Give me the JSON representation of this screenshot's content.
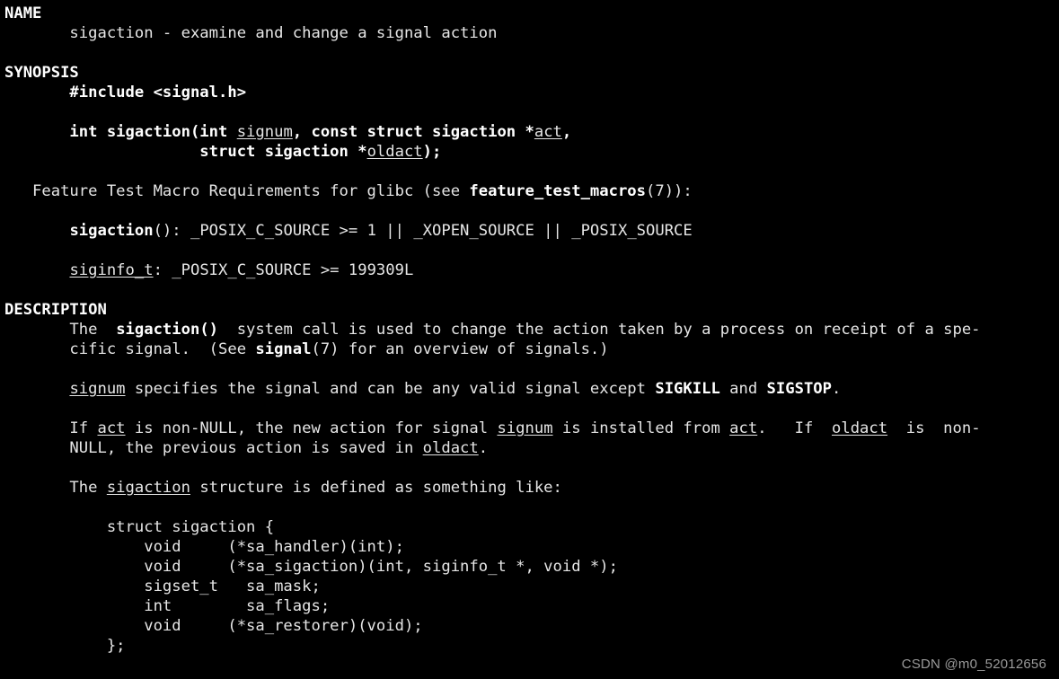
{
  "terminal": {
    "background_color": "#000000",
    "text_color": "#e6e6e6",
    "watermark": "CSDN @m0_52012656"
  },
  "manpage": {
    "sections": {
      "name_heading": "NAME",
      "synopsis_heading": "SYNOPSIS",
      "description_heading": "DESCRIPTION"
    },
    "lines": {
      "name_desc": "       sigaction - examine and change a signal action",
      "synopsis_include": "       #include <signal.h>",
      "proto_1_a": "       int sigaction(int ",
      "proto_1_signum": "signum",
      "proto_1_b": ", const struct sigaction *",
      "proto_1_act": "act",
      "proto_1_c": ",",
      "proto_2_a": "                     struct sigaction *",
      "proto_2_oldact": "oldact",
      "proto_2_b": ");",
      "ftm_a": "   Feature Test Macro Requirements for glibc (see ",
      "ftm_bold": "feature_test_macros",
      "ftm_b": "(7)):",
      "ftm_sigaction_bold": "sigaction",
      "ftm_sigaction_rest": "(): _POSIX_C_SOURCE >= 1 || _XOPEN_SOURCE || _POSIX_SOURCE",
      "ftm_indent": "       ",
      "ftm_siginfo_u": "siginfo_t",
      "ftm_siginfo_rest": ": _POSIX_C_SOURCE >= 199309L",
      "desc_1_a": "       The  ",
      "desc_1_bold": "sigaction()",
      "desc_1_b": "  system call is used to change the action taken by a process on receipt of a spe-",
      "desc_2_a": "       cific signal.  (See ",
      "desc_2_bold": "signal",
      "desc_2_b": "(7) for an overview of signals.)",
      "desc_3_u": "signum",
      "desc_3_a": " specifies the signal and can be any valid signal except ",
      "desc_3_b1": "SIGKILL",
      "desc_3_b": " and ",
      "desc_3_b2": "SIGSTOP",
      "desc_3_c": ".",
      "desc_4_pre": "       If ",
      "desc_4_act": "act",
      "desc_4_mid1": " is non-NULL, the new action for signal ",
      "desc_4_signum": "signum",
      "desc_4_mid2": " is installed from ",
      "desc_4_act2": "act",
      "desc_4_mid3": ".   If  ",
      "desc_4_oldact": "oldact",
      "desc_4_end": "  is  non-",
      "desc_5": "       NULL, the previous action is saved in ",
      "desc_5_oldact": "oldact",
      "desc_5_end": ".",
      "desc_6_pre": "       The ",
      "desc_6_u": "sigaction",
      "desc_6_end": " structure is defined as something like:",
      "struct_1": "           struct sigaction {",
      "struct_2": "               void     (*sa_handler)(int);",
      "struct_3": "               void     (*sa_sigaction)(int, siginfo_t *, void *);",
      "struct_4": "               sigset_t   sa_mask;",
      "struct_5": "               int        sa_flags;",
      "struct_6": "               void     (*sa_restorer)(void);",
      "struct_7": "           };"
    }
  }
}
